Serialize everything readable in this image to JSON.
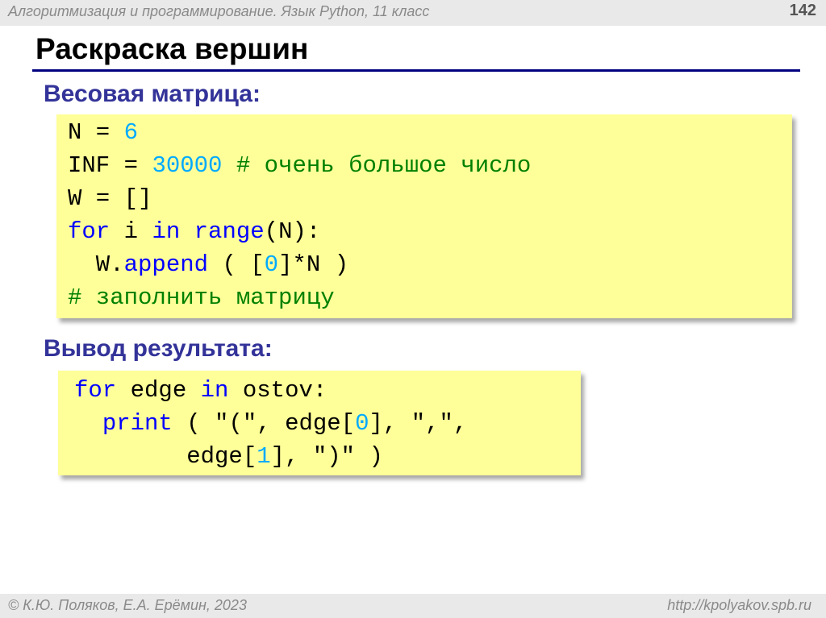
{
  "header": {
    "course": "Алгоритмизация и программирование. Язык Python, 11 класс",
    "page_number": "142"
  },
  "slide": {
    "title": "Раскраска вершин",
    "heading1": "Весовая матрица:",
    "heading2": "Вывод результата:"
  },
  "code1": {
    "line1": [
      "N",
      " = ",
      "6"
    ],
    "line2": [
      "INF",
      " = ",
      "30000",
      " ",
      "# очень большое число"
    ],
    "line3": "W = []",
    "line4": [
      "for",
      " i ",
      "in",
      " ",
      "range",
      "(N):"
    ],
    "line5": [
      "  W.",
      "append",
      " ( [",
      "0",
      "]*N )"
    ],
    "line6": "# заполнить матрицу"
  },
  "code2": {
    "line1": [
      "for",
      " edge ",
      "in",
      " ostov:"
    ],
    "line2": [
      "  ",
      "print",
      " ( ",
      "\"(\"",
      ", edge[",
      "0",
      "], ",
      "\",\"",
      ","
    ],
    "line3": [
      "        edge[",
      "1",
      "], ",
      "\")\"",
      " )"
    ]
  },
  "colors": {
    "keyword": "#0000ff",
    "number": "#00aaff",
    "comment": "#008000",
    "heading": "#333399",
    "code_background": "#ffff99",
    "title_rule": "#000080"
  },
  "footer": {
    "copyright": "© К.Ю. Поляков, Е.А. Ерёмин, 2023",
    "url": "http://kpolyakov.spb.ru"
  }
}
